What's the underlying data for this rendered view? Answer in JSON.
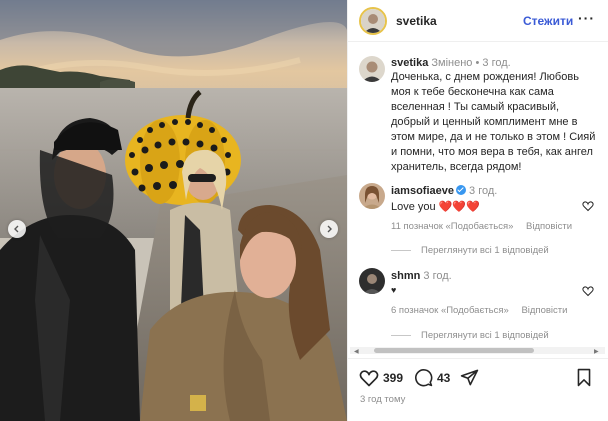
{
  "post": {
    "username": "svetika",
    "follow_label": "Стежити",
    "more_label": "···"
  },
  "caption": {
    "username": "svetika",
    "edited": "Змінено",
    "separator": "•",
    "time": "3 год.",
    "text": "Доченька, с днем рождения!  Любовь моя к тебе бесконечна как сама вселенная !  Ты самый красивый, добрый и  ценный комплимент мне в этом мире, да и не только в этом ! Сияй и помни, что моя вера в тебя, как ангел хранитель, всегда рядом!"
  },
  "comments": [
    {
      "username": "iamsofiaeve",
      "verified": true,
      "time": "3 год.",
      "text": "Love you ❤️❤️❤️",
      "likes": "11 позначок «Подобається»",
      "reply": "Відповісти",
      "view_replies": "Переглянути всі 1 відповідей"
    },
    {
      "username": "shmn",
      "verified": false,
      "time": "3 год.",
      "text": "♥",
      "likes": "6 позначок «Подобається»",
      "reply": "Відповісти",
      "view_replies": "Переглянути всі 1 відповідей"
    }
  ],
  "actions": {
    "like_count": "399",
    "comment_count": "43",
    "time_ago": "3 год тому"
  },
  "icons": {
    "prev": "chevron-left-icon",
    "next": "chevron-right-icon",
    "like": "heart-icon",
    "comment": "comment-icon",
    "share": "send-icon",
    "save": "bookmark-icon"
  },
  "colors": {
    "accent": "#3b5bd6",
    "muted": "#8e8e8e",
    "verified": "#3897f0"
  }
}
